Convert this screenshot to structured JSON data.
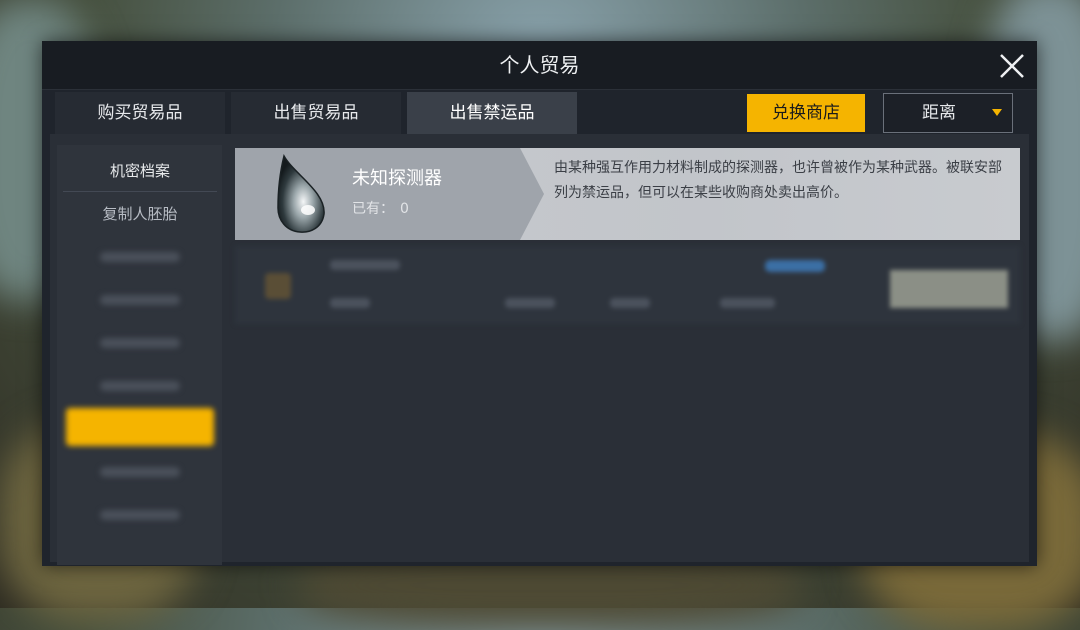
{
  "window": {
    "title": "个人贸易"
  },
  "tabs": [
    {
      "label": "购买贸易品",
      "active": false
    },
    {
      "label": "出售贸易品",
      "active": false
    },
    {
      "label": "出售禁运品",
      "active": true
    }
  ],
  "exchange_button": {
    "label": "兑换商店"
  },
  "sort_dropdown": {
    "selected": "距离"
  },
  "sidebar": {
    "items": [
      {
        "label": "机密档案"
      },
      {
        "label": "复制人胚胎"
      }
    ]
  },
  "item": {
    "name": "未知探测器",
    "owned_label": "已有：",
    "owned_count": "0",
    "description": "由某种强互作用力材料制成的探测器，也许曾被作为某种武器。被联安部列为禁运品，但可以在某些收购商处卖出高价。",
    "icon": "silver-droplet-icon"
  },
  "colors": {
    "accent": "#f5b400",
    "panel": "#1f242c",
    "active_tab": "#3a4049"
  }
}
